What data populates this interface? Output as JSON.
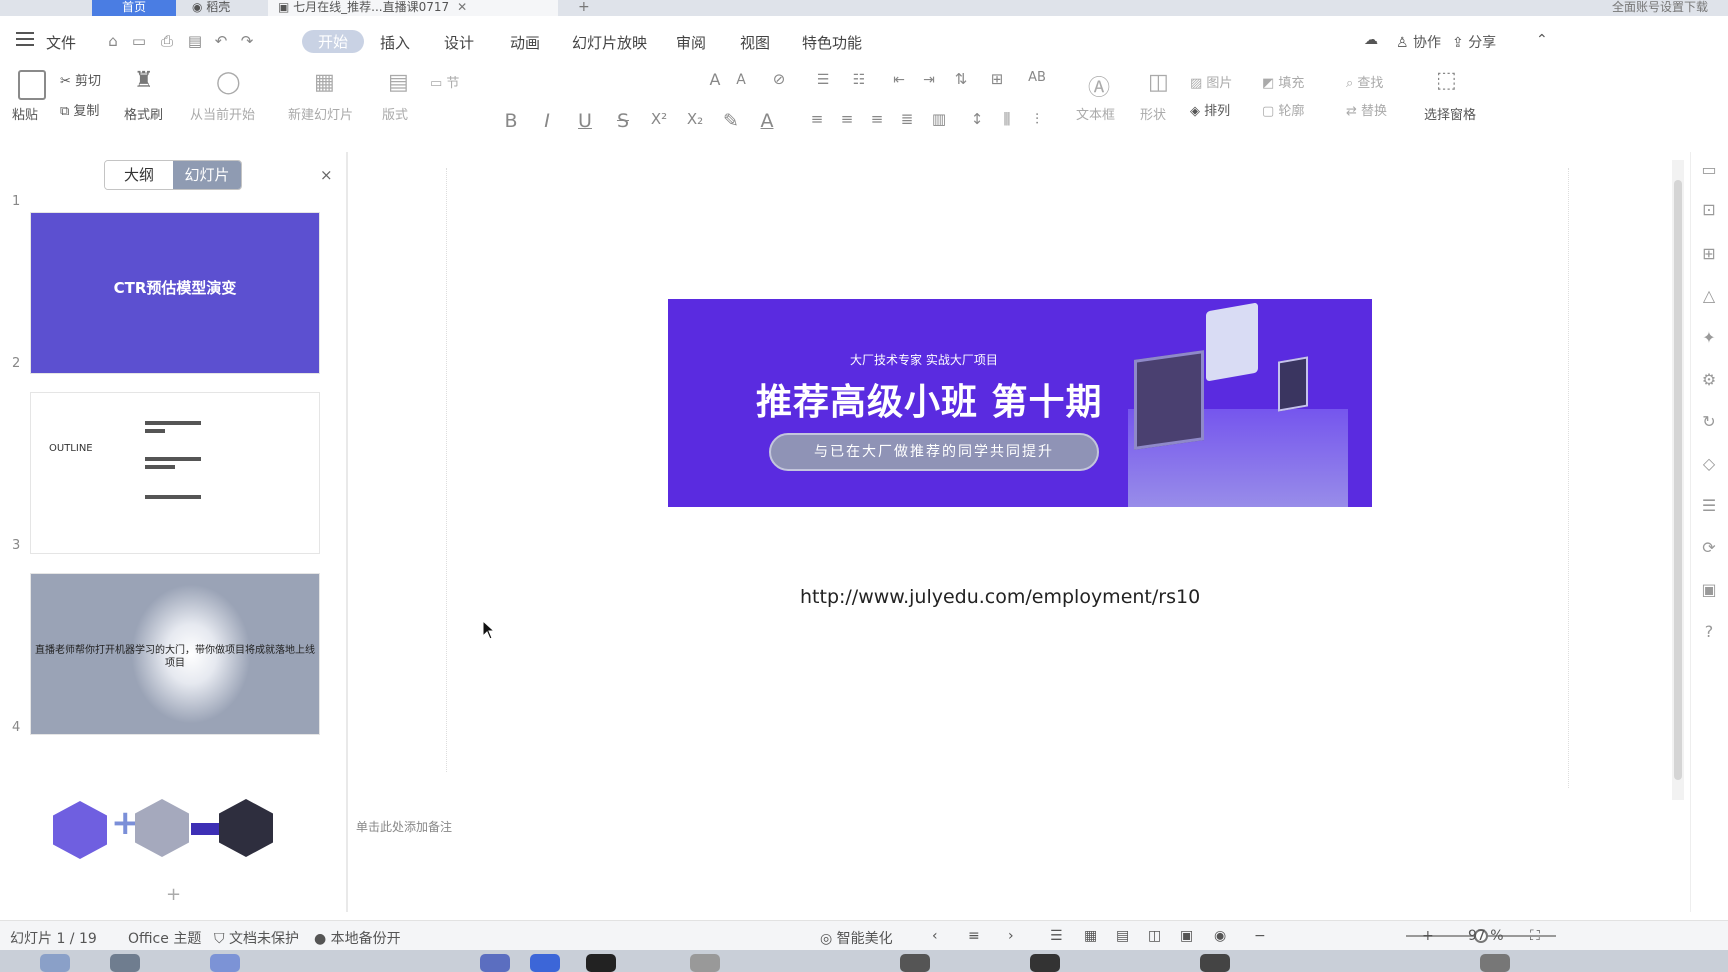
{
  "tabs": {
    "home": "首页",
    "wps": "稻壳",
    "doc": "七月在线_推荐...直播课0717",
    "new_tab": "+",
    "right_info": "全面账号设置下载"
  },
  "menu": {
    "file": "文件",
    "items": [
      "开始",
      "插入",
      "设计",
      "动画",
      "幻灯片放映",
      "审阅",
      "视图",
      "特色功能"
    ],
    "active_index": 0,
    "collaborate": "协作",
    "share": "分享"
  },
  "ribbon": {
    "paste": "粘贴",
    "cut": "剪切",
    "copy": "复制",
    "format_painter": "格式刷",
    "from_current": "从当前开始",
    "new_slide": "新建幻灯片",
    "layout": "版式",
    "section": "节",
    "text_box": "文本框",
    "shape": "形状",
    "arrange": "排列",
    "picture": "图片",
    "fill": "填充",
    "outline": "轮廓",
    "find": "查找",
    "replace": "替换",
    "select_pane": "选择窗格",
    "bold": "B",
    "italic": "I",
    "underline": "U",
    "strike": "S",
    "superscript": "X²",
    "subscript": "X₂",
    "font_color": "A"
  },
  "panel": {
    "tab_outline": "大纲",
    "tab_slides": "幻灯片",
    "close": "×",
    "add_slide": "+"
  },
  "slides": [
    {
      "num": "1",
      "title": "CTR预估模型演变"
    },
    {
      "num": "2",
      "title": "OUTLINE"
    },
    {
      "num": "3",
      "title": "直播老师帮你打开机器学习的大门，带你做项目将成就落地上线项目"
    },
    {
      "num": "4",
      "title": ""
    }
  ],
  "slide_main": {
    "banner_sub": "大厂技术专家   实战大厂项目",
    "banner_headline": "推荐高级小班 第十期",
    "banner_pill": "与已在大厂做推荐的同学共同提升",
    "link": "http://www.julyedu.com/employment/rs10",
    "notes_placeholder": "单击此处添加备注"
  },
  "status": {
    "slide_counter": "幻灯片 1 / 19",
    "theme": "Office 主题",
    "doc_protect": "文档未保护",
    "backup": "本地备份开",
    "beautify": "智能美化",
    "zoom": "97 %"
  },
  "colors": {
    "banner_bg": "#5a2be0",
    "thumb1_bg": "#5c50d0",
    "active_menu": "#c9d2e4",
    "tab_home": "#4a7de3"
  }
}
